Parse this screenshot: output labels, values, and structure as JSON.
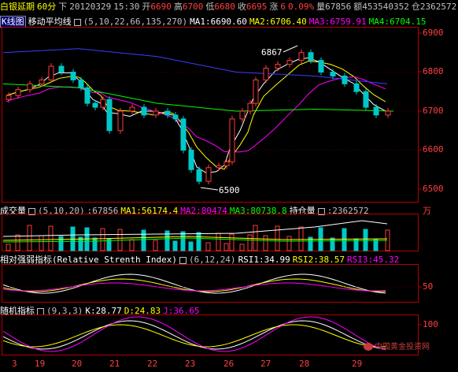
{
  "topbar": {
    "name": "白银延期",
    "period": "60分",
    "direction": "下",
    "date": "20120329",
    "time": "15:30",
    "open_label": "开",
    "open": "6690",
    "high_label": "高",
    "high": "6700",
    "low_label": "低",
    "low": "6680",
    "close_label": "收",
    "close": "6695",
    "change_label": "涨",
    "change": "6",
    "change_pct": "0.09%",
    "volume_label": "量",
    "volume": "67856",
    "amount_label": "额",
    "amount": "453540352",
    "position_label": "仓",
    "position": "2362572"
  },
  "kline_panel": {
    "label": "K线图",
    "ma_title": "移动平均线",
    "ma_params": "(5,10,22,66,135,270)",
    "ma1": "MA1:6690.60",
    "ma2": "MA2:6706.40",
    "ma3": "MA3:6759.91",
    "ma4": "MA4:6704.15",
    "y_labels": [
      "6900",
      "6800",
      "6700",
      "6600",
      "6500"
    ],
    "annot_high": "6867",
    "annot_low": "6500"
  },
  "volume_panel": {
    "title": "成交量",
    "params": "(5,10,20)",
    "value": ":67856",
    "ma1": "MA1:56174.4",
    "ma2": "MA2:80474",
    "ma3": "MA3:80738.8",
    "oi_title": "持仓量",
    "oi_value": ":2362572",
    "unit": "万"
  },
  "rsi_panel": {
    "title": "相对强弱指标(Relative Strenth Index)",
    "params": "(6,12,24)",
    "rsi1": "RSI1:34.99",
    "rsi2": "RSI2:38.57",
    "rsi3": "RSI3:45.32",
    "y_label": "50"
  },
  "kdj_panel": {
    "title": "随机指标",
    "params": "(9,3,3)",
    "k": "K:28.77",
    "d": "D:24.83",
    "j": "J:36.65",
    "y_label": "100"
  },
  "x_axis": [
    "3",
    "19",
    "20",
    "21",
    "22",
    "23",
    "26",
    "27",
    "28",
    "29"
  ],
  "watermark": "中国黄金投资网",
  "colors": {
    "up": "#ff3c3c",
    "down": "#00c8c8",
    "ma1": "#ffffff",
    "ma2": "#ffff00",
    "ma3": "#ff00ff",
    "ma4": "#00ff00",
    "ma5": "#3c3cff",
    "axis": "#b40000",
    "label_red": "#ff4040"
  }
}
